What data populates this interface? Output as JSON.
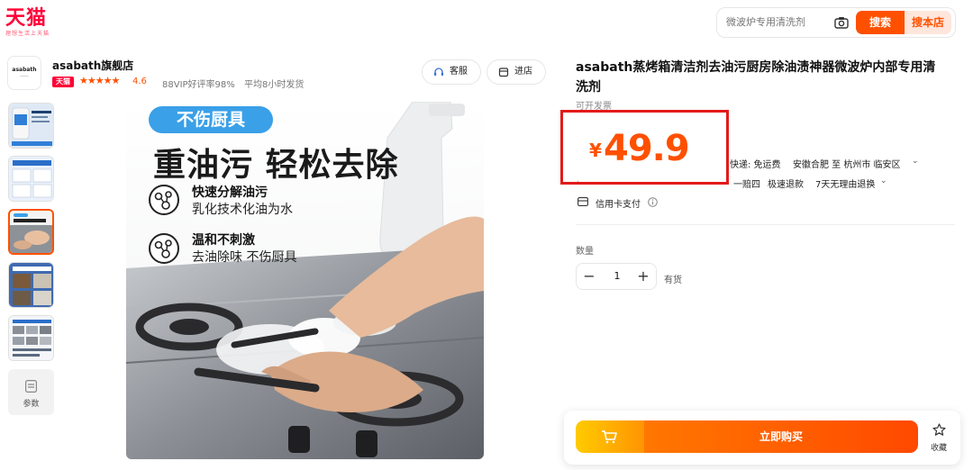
{
  "header": {
    "logo": "天猫",
    "logo_sub": "理想生活上天猫",
    "search_placeholder": "微波炉专用清洗剂",
    "search_button": "搜索",
    "search_store_button": "搜本店"
  },
  "store": {
    "logo_text": "asabath",
    "name": "asabath旗舰店",
    "chevron": "›",
    "badge": "天猫",
    "stars": "★★★★★",
    "rating": "4.6",
    "good_rate": "88VIP好评率98%",
    "ship_time": "平均8小时发货",
    "service_button": "客服",
    "enter_store_button": "进店"
  },
  "thumbnails": {
    "selected_index": 2,
    "params_label": "参数"
  },
  "main_image": {
    "tag": "不伤厨具",
    "headline": "重油污 轻松去除",
    "features": [
      {
        "title": "快速分解油污",
        "desc": "乳化技术化油为水"
      },
      {
        "title": "温和不刺激",
        "desc": "去油除味 不伤厨具"
      }
    ]
  },
  "product": {
    "title_line1": "asabath蒸烤箱清洁剂去油污厨房除油渍神器微波炉内部专用清",
    "title_line2": "洗剂",
    "invoice": "可开发票",
    "price_currency": "¥",
    "price": "49.9",
    "shipping_label": "快递: 免运费",
    "ship_from": "安徽合肥 至 杭州市 临安区",
    "service_1": "一赔四",
    "service_2": "极速退款",
    "service_3": "7天无理由退换",
    "payment": "信用卡支付",
    "quantity_label": "数量",
    "quantity": "1",
    "stock": "有货"
  },
  "actions": {
    "buy_now": "立即购买",
    "favorite": "收藏"
  },
  "colors": {
    "accent": "#ff5000",
    "tmall_red": "#ff0036",
    "annotation_red": "#e21b1b"
  }
}
